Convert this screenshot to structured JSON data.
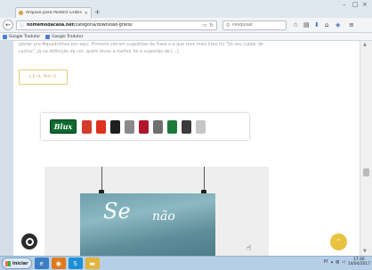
{
  "browser": {
    "tab_title": "Arquivo para Posters Grátis - Home",
    "tab_close": "×",
    "new_tab": "+",
    "window_min": "–",
    "window_max": "□",
    "window_close": "×",
    "back_glyph": "←",
    "url_host": "homemodacasa.net",
    "url_path": "/categoria/download-gratis/",
    "search_placeholder": "Pesquisar",
    "bookmarks": [
      "Google Tradutor",
      "Google Tradutor"
    ]
  },
  "article": {
    "paragraph": "pôster pra #quadrinhos por aqui. Primeiro vieram sugestões de frase e a que teve mais likes foi \"Só seu cuidar de cactus\", já na definição da cor, quem levou a melhor foi a sugestão de [...]",
    "read_more": "LEIA MAIS"
  },
  "banner": {
    "brand": "Blux",
    "product_colors": [
      "#d33b2a",
      "#e0301e",
      "#1e1e1e",
      "#8a8a8a",
      "#b0172b",
      "#6f6f6f",
      "#1f7a3a",
      "#3b3b3b",
      "#c6c6c6"
    ]
  },
  "poster": {
    "line1": "Se",
    "line2": "não"
  },
  "taskbar": {
    "start_label": "Iniciar",
    "tray_lang": "PT",
    "time": "17:46",
    "date": "14/04/2017"
  },
  "colors": {
    "accent_gold": "#e8c240",
    "brand_green": "#0e6a2e"
  }
}
